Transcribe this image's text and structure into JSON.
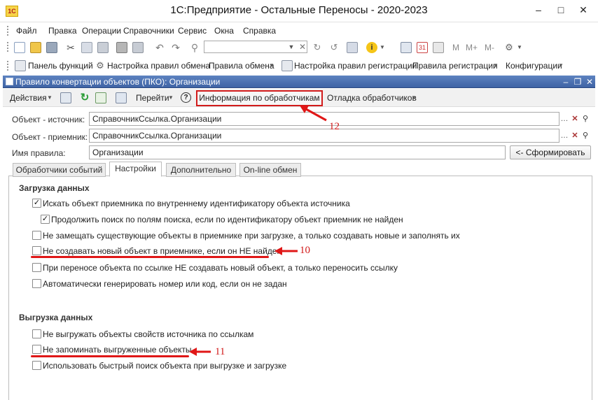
{
  "window": {
    "title": "1С:Предприятие - Остальные Переносы - 2020-2023",
    "logo": "1С",
    "controls": [
      "–",
      "□",
      "✕"
    ]
  },
  "menu": [
    "Файл",
    "Правка",
    "Операции",
    "Справочники",
    "Сервис",
    "Окна",
    "Справка"
  ],
  "toolbar2": {
    "panel_functions": "Панель функций",
    "exchange_settings": "Настройка правил обмена",
    "exchange_rules": "Правила обмена",
    "registration_settings": "Настройка правил регистрации",
    "registration_rules": "Правила регистрации",
    "configurations": "Конфигурации"
  },
  "toolbar1": {
    "m_buttons": [
      "M",
      "M+",
      "M-"
    ]
  },
  "inner": {
    "title": "Правило конвертации объектов (ПКО): Организации",
    "controls": [
      "–",
      "❐",
      "✕"
    ]
  },
  "form_toolbar": {
    "actions": "Действия",
    "goto": "Перейти",
    "help": "?",
    "handlers_info": "Информация по обработчикам ...",
    "debug_handlers": "Отладка обработчиков"
  },
  "fields": {
    "source_label": "Объект - источник:",
    "source_value": "СправочникСсылка.Организации",
    "dest_label": "Объект - приемник:",
    "dest_value": "СправочникСсылка.Организации",
    "name_label": "Имя правила:",
    "name_value": "Организации",
    "generate_button": "<- Сформировать"
  },
  "tabs": [
    "Обработчики событий",
    "Настройки",
    "Дополнительно",
    "On-line обмен"
  ],
  "active_tab": "Настройки",
  "load_section": {
    "title": "Загрузка данных",
    "options": [
      {
        "label": "Искать объект приемника по внутреннему идентификатору объекта источника",
        "checked": true
      },
      {
        "label": "Продолжить поиск по полям поиска, если по идентификатору объект приемник не найден",
        "checked": true
      },
      {
        "label": "Не замещать существующие объекты в приемнике при загрузке, а только создавать новые и заполнять их",
        "checked": false
      },
      {
        "label": "Не создавать новый объект в приемнике, если он НЕ найден",
        "checked": false
      },
      {
        "label": "При переносе объекта по ссылке НЕ создавать новый объект, а только переносить ссылку",
        "checked": false
      },
      {
        "label": "Автоматически генерировать номер или код, если он не задан",
        "checked": false
      }
    ]
  },
  "unload_section": {
    "title": "Выгрузка данных",
    "options": [
      {
        "label": "Не выгружать объекты свойств источника по ссылкам",
        "checked": false
      },
      {
        "label": "Не запоминать выгруженные объекты",
        "checked": false
      },
      {
        "label": "Использовать быстрый поиск объекта при выгрузке и загрузке",
        "checked": false
      }
    ]
  },
  "annotations": [
    "12",
    "10",
    "11"
  ],
  "colors": {
    "annotation_red": "#d21b1b",
    "header_blue": "#4a6fb0"
  }
}
